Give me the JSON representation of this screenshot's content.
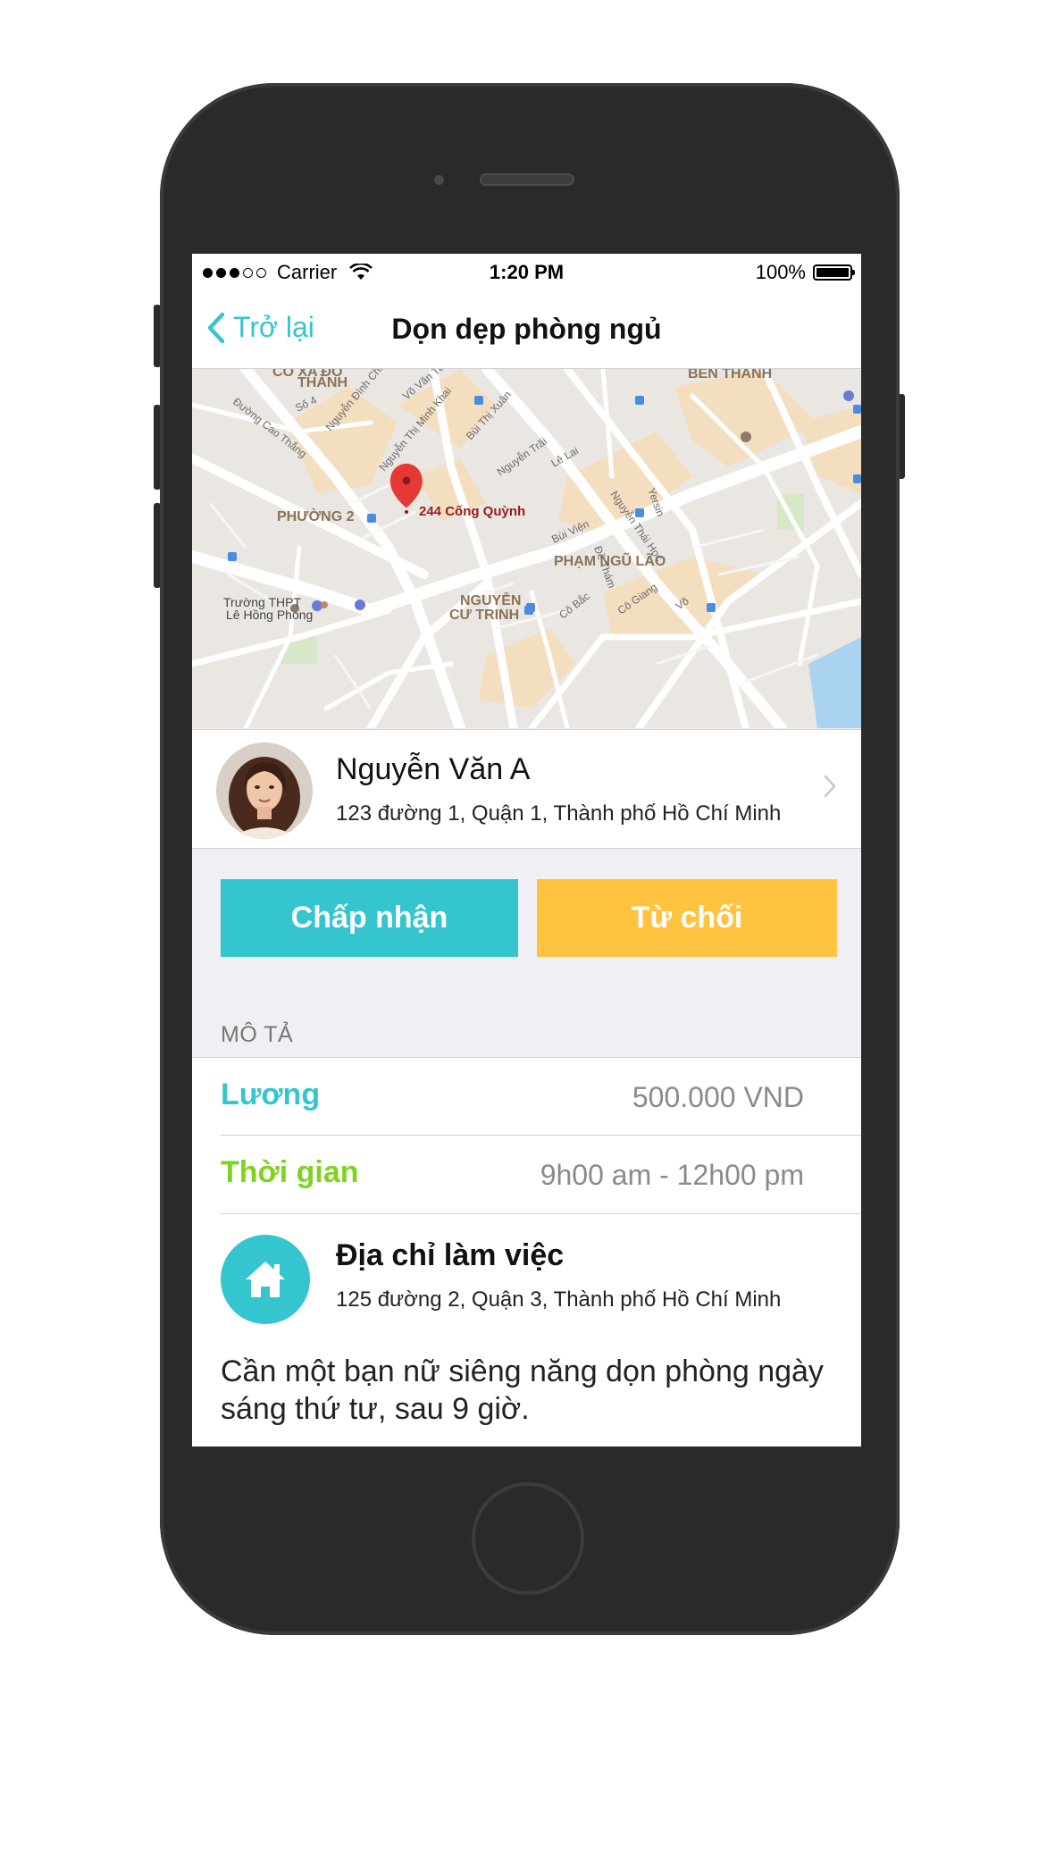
{
  "status_bar": {
    "carrier": "Carrier",
    "time": "1:20 PM",
    "battery": "100%"
  },
  "nav": {
    "back_label": "Trở lại",
    "title": "Dọn dẹp phòng ngủ"
  },
  "map": {
    "marker_label": "244 Cống Quỳnh",
    "area_labels": {
      "ben_thanh": "BẾN THÀNH",
      "phuong2": "PHƯỜNG 2",
      "pham_ngu_lao": "PHẠM NGŨ LÃO",
      "nguyen_cu_trinh_1": "NGUYỄN",
      "nguyen_cu_trinh_2": "CƯ TRINH",
      "co_xa_do_1": "CÔ XA ĐÔ",
      "co_xa_do_2": "THÀNH",
      "school_1": "Trường THPT",
      "school_2": "Lê Hồng Phong"
    },
    "street_labels": {
      "cao_thang": "Đường Cao Thắng",
      "so4": "Số 4",
      "nguyen_dinh_chieu": "Nguyễn Đình Chiểu",
      "vo_van_tan": "Võ Văn Tần",
      "nguyen_thi_minh_khai": "Nguyễn Thị Minh Khai",
      "bui_thi_xuan": "Bùi Thị Xuân",
      "nguyen_trai": "Nguyễn Trãi",
      "le_lai": "Lê Lai",
      "yersin": "Yersin",
      "bui_vien": "Bùi Viện",
      "nguyen_thai_hoc": "Nguyễn Thái Học",
      "de_tham": "Đề Thám",
      "co_bac": "Cô Bắc",
      "co_giang": "Cô Giang",
      "vo": "Võ"
    },
    "colors": {
      "land": "#eae7e3",
      "road": "#ffffff",
      "block": "#f3dfc0",
      "marker": "#e53935"
    }
  },
  "profile": {
    "name": "Nguyễn Văn A",
    "address": "123 đường 1, Quận 1, Thành phố Hồ Chí Minh",
    "avatar_icon": "avatar-photo"
  },
  "actions": {
    "accept_label": "Chấp nhận",
    "reject_label": "Từ chối",
    "accept_color": "#34c5cf",
    "reject_color": "#ffc33f"
  },
  "section": {
    "header": "MÔ TẢ"
  },
  "details": {
    "salary_label": "Lương",
    "salary_value": "500.000 VND",
    "time_label": "Thời gian",
    "time_value": "9h00 am - 12h00 pm",
    "salary_color": "#34c5cf",
    "time_color": "#7ed321"
  },
  "work_location": {
    "title": "Địa chỉ làm việc",
    "address": "125 đường 2, Quận 3, Thành phố Hồ Chí Minh",
    "icon": "home-icon"
  },
  "description": "Cần một bạn nữ siêng năng dọn phòng ngày sáng thứ tư, sau 9 giờ."
}
